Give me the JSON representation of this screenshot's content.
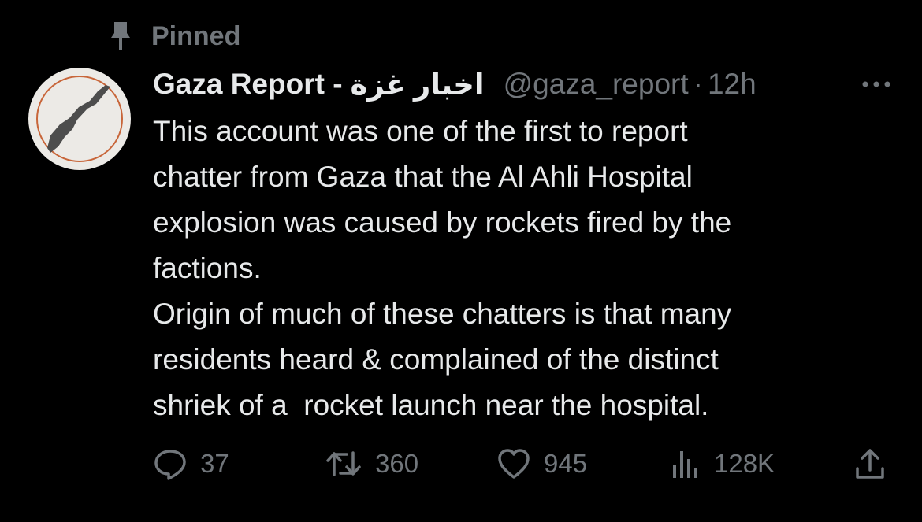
{
  "pinned": {
    "label": "Pinned"
  },
  "tweet": {
    "display_name": "Gaza Report -",
    "display_name_arabic": "اخبار غزة",
    "handle": "@gaza_report",
    "separator": "·",
    "time": "12h",
    "text_lines": [
      "This account was one of the first to report",
      "chatter from Gaza that the Al Ahli Hospital",
      "explosion was caused by rockets fired by the",
      "factions.",
      "Origin of much of these chatters is that many",
      "residents heard & complained of the distinct",
      "shriek of a  rocket launch near the hospital."
    ]
  },
  "actions": {
    "replies": "37",
    "reposts": "360",
    "likes": "945",
    "views": "128K"
  },
  "colors": {
    "background": "#000000",
    "text_primary": "#e7e9ea",
    "text_secondary": "#71767b",
    "avatar_bg": "#eceae6",
    "avatar_ring": "#c8663a"
  },
  "icons": {
    "pin": "pin-icon",
    "more": "more-icon",
    "reply": "reply-icon",
    "repost": "repost-icon",
    "like": "heart-icon",
    "views": "views-icon",
    "share": "share-icon"
  }
}
